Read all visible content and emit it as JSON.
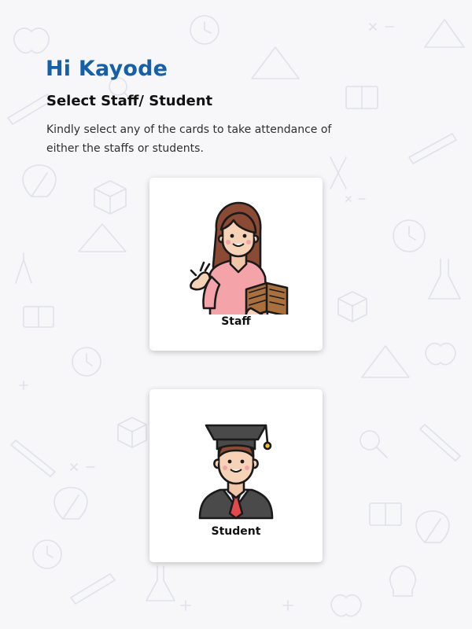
{
  "header": {
    "greeting": "Hi Kayode",
    "subtitle": "Select Staff/ Student",
    "description": "Kindly select any of the cards to take attendance of either the staffs or students."
  },
  "cards": [
    {
      "label": "Staff",
      "icon": "teacher-icon"
    },
    {
      "label": "Student",
      "icon": "graduate-student-icon"
    }
  ],
  "colors": {
    "greeting": "#1560a8",
    "background": "#f7f7f9",
    "card": "#ffffff"
  }
}
